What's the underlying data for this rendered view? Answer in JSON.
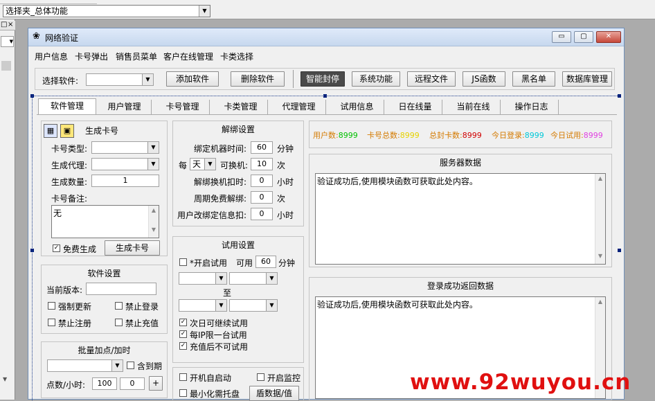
{
  "ide": {
    "object_combo": "选择夹_总体功能",
    "close_glyph": "×",
    "pin_glyph": "□"
  },
  "window": {
    "title": "网络验证",
    "menu": [
      "用户信息",
      "卡号弹出",
      "销售员菜单",
      "客户在线管理",
      "卡类选择"
    ],
    "toolbar": {
      "select_label": "选择软件:",
      "buttons": [
        "添加软件",
        "删除软件",
        "智能封停",
        "系统功能",
        "远程文件",
        "JS函数",
        "黑名单",
        "数据库管理"
      ]
    },
    "tabs": [
      "软件管理",
      "用户管理",
      "卡号管理",
      "卡类管理",
      "代理管理",
      "试用信息",
      "日在线量",
      "当前在线",
      "操作日志"
    ],
    "generate": {
      "title": "生成卡号",
      "card_type": "卡号类型:",
      "agent": "生成代理:",
      "count": "生成数量:",
      "count_value": "1",
      "note": "卡号备注:",
      "note_value": "无",
      "free": "免费生成",
      "button": "生成卡号"
    },
    "unbind": {
      "title": "解绑设置",
      "bind_time": "绑定机器时间:",
      "bind_value": "60",
      "bind_unit": "分钟",
      "every": "每",
      "period": "天",
      "change": "可换机:",
      "change_value": "10",
      "change_unit": "次",
      "deduct": "解绑换机扣时:",
      "deduct_value": "0",
      "deduct_unit": "小时",
      "free_unbind": "周期免费解绑:",
      "free_value": "0",
      "free_unit": "次",
      "user_change": "用户改绑定信息扣:",
      "user_value": "0",
      "user_unit": "小时"
    },
    "stats": {
      "users": "用户数:",
      "users_value": "8999",
      "cards": "卡号总数:",
      "cards_value": "8999",
      "sealed": "总封卡数:",
      "sealed_value": "8999",
      "login": "今日登录:",
      "login_value": "8999",
      "trial": "今日试用:",
      "trial_value": "8999",
      "colors": {
        "label": "#d47a00",
        "users": "#00c000",
        "cards": "#e6d200",
        "sealed": "#d00000",
        "login": "#00c8d8",
        "trial": "#e040e0"
      }
    },
    "server": {
      "title": "服务器数据",
      "text": "验证成功后,使用模块函数可获取此处内容。"
    },
    "login_data": {
      "title": "登录成功返回数据",
      "text": "验证成功后,使用模块函数可获取此处内容。"
    },
    "software": {
      "title": "软件设置",
      "version": "当前版本:",
      "force_update": "强制更新",
      "no_login": "禁止登录",
      "no_register": "禁止注册",
      "no_recharge": "禁止充值"
    },
    "trial": {
      "title": "试用设置",
      "enable": "*开启试用",
      "available": "可用",
      "minutes": "60",
      "unit": "分钟",
      "to": "至",
      "next_day": "次日可继续试用",
      "one_per_ip": "每IP限一台试用",
      "no_after_recharge": "充值后不可试用"
    },
    "batch": {
      "title": "批量加点/加时",
      "expire": "含到期",
      "points_hours": "点数/小时:",
      "v1": "100",
      "v2": "0",
      "plus": "+"
    },
    "bottom": {
      "autostart": "开机自启动",
      "monitor": "开启监控",
      "tray": "最小化需托盘",
      "save": "盾数据/值"
    }
  },
  "watermark": "www.92wuyou.cn"
}
